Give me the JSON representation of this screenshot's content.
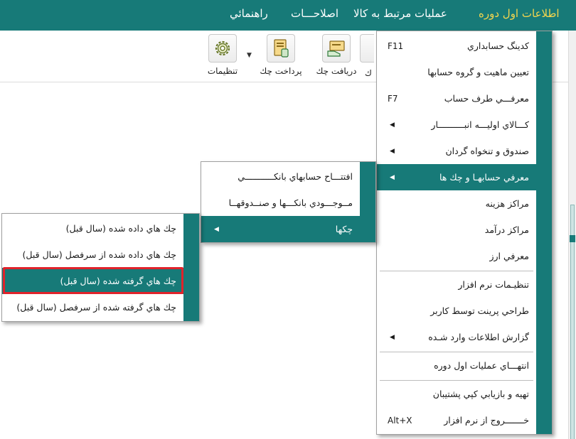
{
  "menubar": {
    "items": [
      {
        "label": "اطلاعات اول دوره",
        "active": true
      },
      {
        "label": "عمليات مرتبط به کالا",
        "active": false
      },
      {
        "label": "اصلاحـــات",
        "active": false
      },
      {
        "label": "راهنمائي",
        "active": false
      }
    ]
  },
  "toolbar": {
    "buttons": [
      {
        "label": "تنظيمات",
        "icon": "gear-icon"
      },
      {
        "label": "پرداخت چك",
        "icon": "pay-check-icon"
      },
      {
        "label": "دريافت چك",
        "icon": "receive-check-icon"
      }
    ],
    "partial_label": "ك"
  },
  "main_menu": {
    "items": [
      {
        "label": "كدينگ حسابداري",
        "shortcut": "F11",
        "submenu": false
      },
      {
        "label": "تعيين ماهيت و گروه حسابها",
        "shortcut": "",
        "submenu": false
      },
      {
        "label": "معرفـــي طرف حساب",
        "shortcut": "F7",
        "submenu": false
      },
      {
        "label": "كـــالاي اوليـــه انبــــــــــار",
        "shortcut": "",
        "submenu": true
      },
      {
        "label": "صندوق و تنخواه گردان",
        "shortcut": "",
        "submenu": true
      },
      {
        "label": "معرفي حسابهـا و چك ها",
        "shortcut": "",
        "submenu": true,
        "highlighted": true
      },
      {
        "label": "مراكز هزينه",
        "shortcut": "",
        "submenu": false
      },
      {
        "label": "مراكز درآمد",
        "shortcut": "",
        "submenu": false
      },
      {
        "label": "معرفي ارز",
        "shortcut": "",
        "submenu": false
      },
      {
        "label": "تنظيـمات نرم افزار",
        "shortcut": "",
        "submenu": false
      },
      {
        "label": "طراحي پرينت توسط كاربر",
        "shortcut": "",
        "submenu": false
      },
      {
        "label": "گزارش اطلاعات وارد شـده",
        "shortcut": "",
        "submenu": true
      },
      {
        "label": "انتهـــاي عمليات اول دوره",
        "shortcut": "",
        "submenu": false
      },
      {
        "label": "تهيه و بازيابي كپي پشتيبان",
        "shortcut": "",
        "submenu": false
      },
      {
        "label": "خـــــــروج از نرم افزار",
        "shortcut": "Alt+X",
        "submenu": false
      }
    ]
  },
  "sub_menu": {
    "items": [
      {
        "label": "افتتـــاح حسابهاي بانكـــــــــــي",
        "submenu": false
      },
      {
        "label": "مــوجـــودي بانكـــها و صنــدوقهــا",
        "submenu": false
      },
      {
        "label": "چكها",
        "submenu": true,
        "highlighted": true
      }
    ]
  },
  "check_menu": {
    "items": [
      {
        "label": "چك هاي داده شده (سال قبل)"
      },
      {
        "label": "چك هاي داده شده از سرفصل  (سال قبل)"
      },
      {
        "label": "چك هاي گرفته شده (سال قبل)",
        "highlighted": true
      },
      {
        "label": "چك هاي گرفته شده از سرفصل (سال قبل)"
      }
    ]
  },
  "colors": {
    "accent": "#177a78",
    "active_menu_text": "#f3d54e",
    "callout_border": "#e0232b"
  }
}
